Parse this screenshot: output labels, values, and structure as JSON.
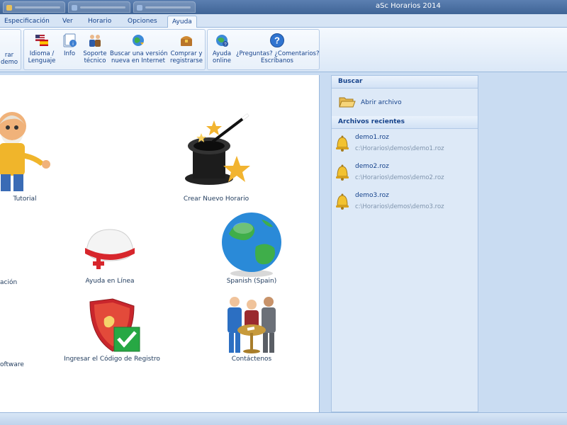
{
  "window": {
    "title": "aSc Horarios 2014"
  },
  "ribbon_tabs": [
    "Especificación",
    "Ver",
    "Horario",
    "Opciones",
    "Ayuda"
  ],
  "active_tab": "Ayuda",
  "ribbon": {
    "partial_button": {
      "line1": "rar",
      "line2": "demo"
    },
    "buttons": [
      {
        "line1": "Idioma /",
        "line2": "Lenguaje"
      },
      {
        "line1": "Info",
        "line2": ""
      },
      {
        "line1": "Soporte",
        "line2": "técnico"
      },
      {
        "line1": "Buscar una versión",
        "line2": "nueva en Internet"
      },
      {
        "line1": "Comprar y",
        "line2": "registrarse"
      },
      {
        "line1": "Ayuda",
        "line2": "online"
      },
      {
        "line1": "¿Preguntas? ¿Comentarios?",
        "line2": "Escríbanos"
      }
    ]
  },
  "main": {
    "tiles": [
      "Tutorial",
      "Crear Nuevo Horario",
      "ación",
      "Ayuda en Línea",
      "Spanish (Spain)",
      "oftware",
      "Ingresar el Código de Registro",
      "Contáctenos"
    ]
  },
  "side": {
    "search_header": "Buscar",
    "open_file": "Abrir archivo",
    "recent_header": "Archivos recientes",
    "recent": [
      {
        "name": "demo1.roz",
        "path": "c:\\Horarios\\demos\\demo1.roz"
      },
      {
        "name": "demo2.roz",
        "path": "c:\\Horarios\\demos\\demo2.roz"
      },
      {
        "name": "demo3.roz",
        "path": "c:\\Horarios\\demos\\demo3.roz"
      }
    ]
  },
  "colors": {
    "accent": "#15428b",
    "panel": "#dde9f7",
    "frame": "#c9dcf2"
  }
}
